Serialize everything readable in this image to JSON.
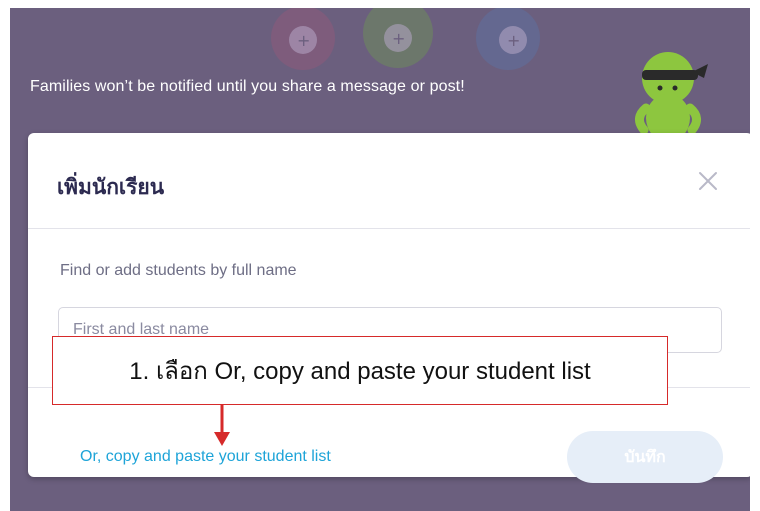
{
  "banner": {
    "notice": "Families won’t be notified until you share a message or post!"
  },
  "modal": {
    "title": "เพิ่มนักเรียน",
    "close_icon": "close-icon",
    "field_label": "Find or add students by full name",
    "name_input": {
      "value": "",
      "placeholder": "First and last name"
    },
    "copy_paste_link": "Or, copy and paste your student list",
    "save_label": "บันทึก"
  },
  "annotation": {
    "callout_text": "1. เลือก Or, copy and paste your student list"
  },
  "colors": {
    "backdrop": "#6b5f7e",
    "link": "#1ea4d8",
    "save_button_disabled": "#e6eef8",
    "annotation": "#d62a2a",
    "mascot": "#8dc63f"
  }
}
